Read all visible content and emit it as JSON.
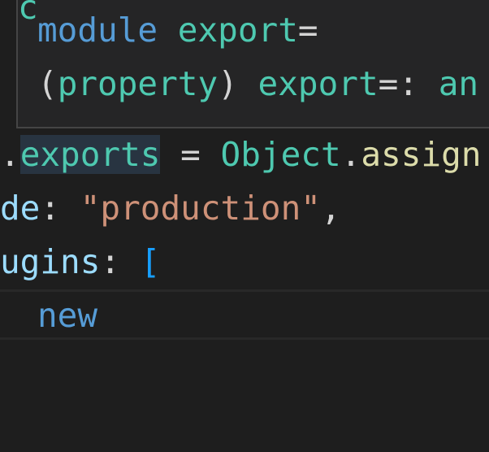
{
  "hover": {
    "peek_char": "c",
    "line1": {
      "keyword": "module",
      "name": "export",
      "op": "="
    },
    "line2": {
      "open": "(",
      "kind": "property",
      "close": ")",
      "name": "export",
      "op": "=:",
      "type_start": "an"
    }
  },
  "code": {
    "line1": {
      "prefix": ".",
      "word": "exports",
      "op": " = ",
      "obj": "Object",
      "dot": ".",
      "method": "assign"
    },
    "line2": {
      "key": "de",
      "colon": ": ",
      "value": "\"production\"",
      "comma": ","
    },
    "line3": {
      "key": "ugins",
      "colon": ": ",
      "bracket": "["
    },
    "line4": {
      "keyword": "new"
    }
  }
}
